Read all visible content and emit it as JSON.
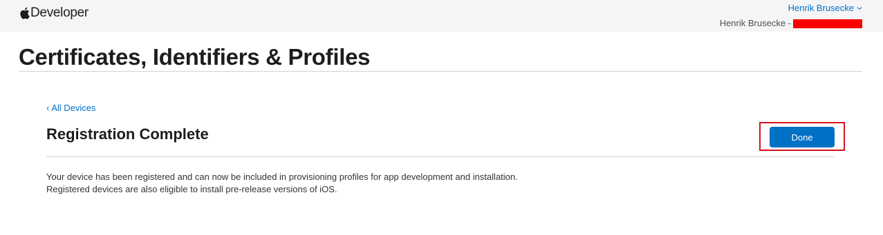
{
  "header": {
    "brand_text": "Developer",
    "brand_icon": "apple-logo-icon",
    "account_name": "Henrik Brusecke",
    "account_chevron_icon": "chevron-down-icon",
    "team_prefix": "Henrik Brusecke -",
    "redaction_color": "#ff0000"
  },
  "page": {
    "title": "Certificates, Identifiers & Profiles"
  },
  "content": {
    "back_link": "‹ All Devices",
    "section_title": "Registration Complete",
    "done_label": "Done",
    "description_lines": [
      "Your device has been registered and can now be included in provisioning profiles for app development and installation.",
      "Registered devices are also eligible to install pre-release versions of iOS."
    ]
  },
  "colors": {
    "link": "#0070c9",
    "primary_button": "#0071c5",
    "highlight_border": "#d6131d",
    "header_background": "#f5f5f7"
  }
}
